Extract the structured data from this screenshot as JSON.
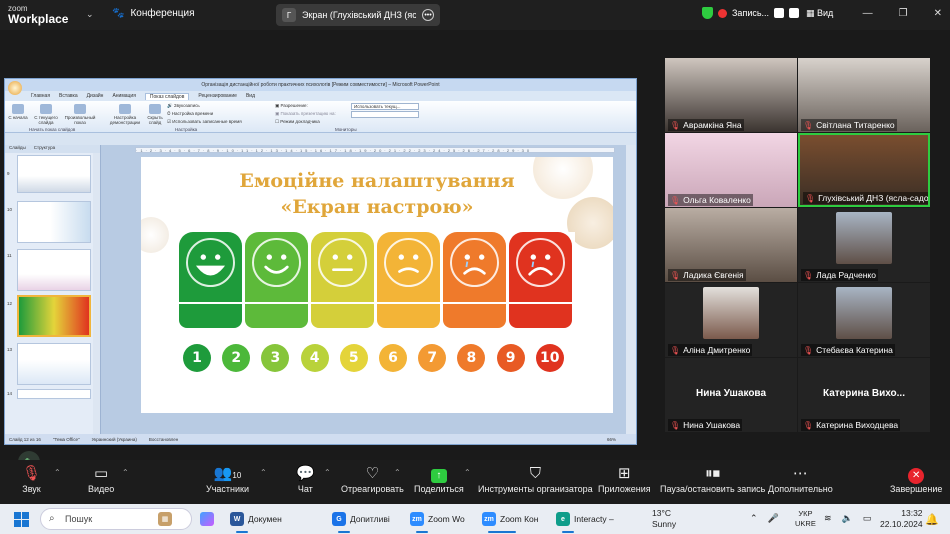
{
  "app": {
    "logo_top": "zoom",
    "logo_bottom": "Workplace",
    "conference_label": "Конференция",
    "screen_share_badge": "Г",
    "screen_share_title": "Экран (Глухівський ДНЗ (ясла-садок)",
    "recording_label": "Запись...",
    "view_label": "Вид"
  },
  "powerpoint": {
    "window_title": "Організація дистанційної роботи практичних психологів [Режим совместимости] – Microsoft PowerPoint",
    "tabs": [
      "Главная",
      "Вставка",
      "Дизайн",
      "Анимация",
      "Показ слайдов",
      "Рецензирование",
      "Вид"
    ],
    "active_tab": "Показ слайдов",
    "ribbon_buttons": [
      "С начала",
      "С текущего слайда",
      "Произвольный показ",
      "Настройка демонстрации",
      "Скрыть слайд"
    ],
    "ribbon_options": [
      "Звукозапись",
      "Настройка времени",
      "Использовать записанные время"
    ],
    "ribbon_monitor_labels": [
      "Разрешение:",
      "Показать презентацию на:",
      "Режим докладчика"
    ],
    "resolution_value": "Использовать текущ...",
    "group_labels": [
      "Начать показ слайдов",
      "Настройка",
      "Мониторы"
    ],
    "panel_tabs": [
      "Слайды",
      "Структура"
    ],
    "thumb_numbers": [
      "9",
      "10",
      "11",
      "12",
      "13",
      "14"
    ],
    "status": [
      "Слайд 12 из 16",
      "\"Тема Office\"",
      "Украинский (Украина)",
      "Восстановлен"
    ],
    "zoom_value": "66%"
  },
  "slide": {
    "title_line1": "Емоційне налаштування",
    "title_line2": "«Екран настрою»",
    "faces": [
      {
        "num": "1",
        "color": "#1e9b3b"
      },
      {
        "num": "2",
        "color": "#4cb83a"
      },
      {
        "num": "3",
        "color": "#86c53a"
      },
      {
        "num": "4",
        "color": "#b9d23a"
      },
      {
        "num": "5",
        "color": "#e4d43a"
      },
      {
        "num": "6",
        "color": "#f3b437"
      },
      {
        "num": "7",
        "color": "#f39a33"
      },
      {
        "num": "8",
        "color": "#ef7a2b"
      },
      {
        "num": "9",
        "color": "#e85a24"
      },
      {
        "num": "10",
        "color": "#e0331f"
      }
    ]
  },
  "participants": [
    {
      "name": "Аврамкіна Яна",
      "muted": true,
      "style": "video"
    },
    {
      "name": "Світлана Титаренко",
      "muted": true,
      "style": "video"
    },
    {
      "name": "Ольга Коваленко",
      "muted": true,
      "style": "video"
    },
    {
      "name": "Глухівський ДНЗ (ясла-садок)...",
      "muted": true,
      "style": "video",
      "active": true
    },
    {
      "name": "Ладика Євгенія",
      "muted": true,
      "style": "video"
    },
    {
      "name": "Лада Радченко",
      "muted": true,
      "style": "photo"
    },
    {
      "name": "Аліна Дмитренко",
      "muted": true,
      "style": "photo"
    },
    {
      "name": "Стебаєва Катерина",
      "muted": true,
      "style": "photo"
    },
    {
      "name": "Нина Ушакова",
      "muted": true,
      "style": "name",
      "big": "Нина Ушакова"
    },
    {
      "name": "Катерина Виходцева",
      "muted": true,
      "style": "name",
      "big": "Катерина  Вихо..."
    }
  ],
  "toolbar": {
    "mute": "Звук",
    "video": "Видео",
    "participants": "Участники",
    "participants_count": "10",
    "chat": "Чат",
    "react": "Отреагировать",
    "share": "Поделиться",
    "host_tools": "Инструменты организатора",
    "apps": "Приложения",
    "pause_rec": "Пауза/остановить запись",
    "more": "Дополнительно",
    "end": "Завершение"
  },
  "taskbar": {
    "search_placeholder": "Пошук",
    "apps": [
      {
        "label": "Докумен",
        "badge": "W",
        "color": "#2b579a"
      },
      {
        "label": "Допитливі",
        "badge": "G",
        "color": "#1a73e8"
      },
      {
        "label": "Zoom Wo",
        "badge": "zm",
        "color": "#2d8cff"
      },
      {
        "label": "Zoom Кон",
        "badge": "zm",
        "color": "#2d8cff"
      },
      {
        "label": "Interacty –",
        "badge": "e",
        "color": "#0f9d8a"
      }
    ],
    "weather_temp": "13°C",
    "weather_desc": "Sunny",
    "lang_top": "УКР",
    "lang_bottom": "UKRE",
    "time": "13:32",
    "date": "22.10.2024"
  },
  "colors": {
    "active_speaker": "#2ecc40",
    "end_button": "#e8242d",
    "share_button": "#2ecc40",
    "slide_title": "#e0a63a"
  }
}
